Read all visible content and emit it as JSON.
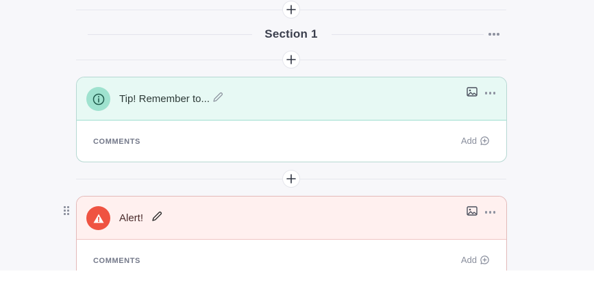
{
  "section": {
    "title": "Section 1"
  },
  "cards": [
    {
      "type": "tip",
      "icon": "info-icon",
      "title": "Tip! Remember to...",
      "comments_label": "COMMENTS",
      "add_label": "Add",
      "accent": "#9fe2cf"
    },
    {
      "type": "alert",
      "icon": "warning-icon",
      "title": "Alert!",
      "comments_label": "COMMENTS",
      "add_label": "Add",
      "accent": "#ef5342"
    }
  ],
  "icons": {
    "add_block": "plus-icon",
    "more": "more-options-icon",
    "image": "image-icon",
    "edit": "pencil-icon",
    "comment": "comment-add-icon",
    "drag": "drag-handle-icon"
  }
}
